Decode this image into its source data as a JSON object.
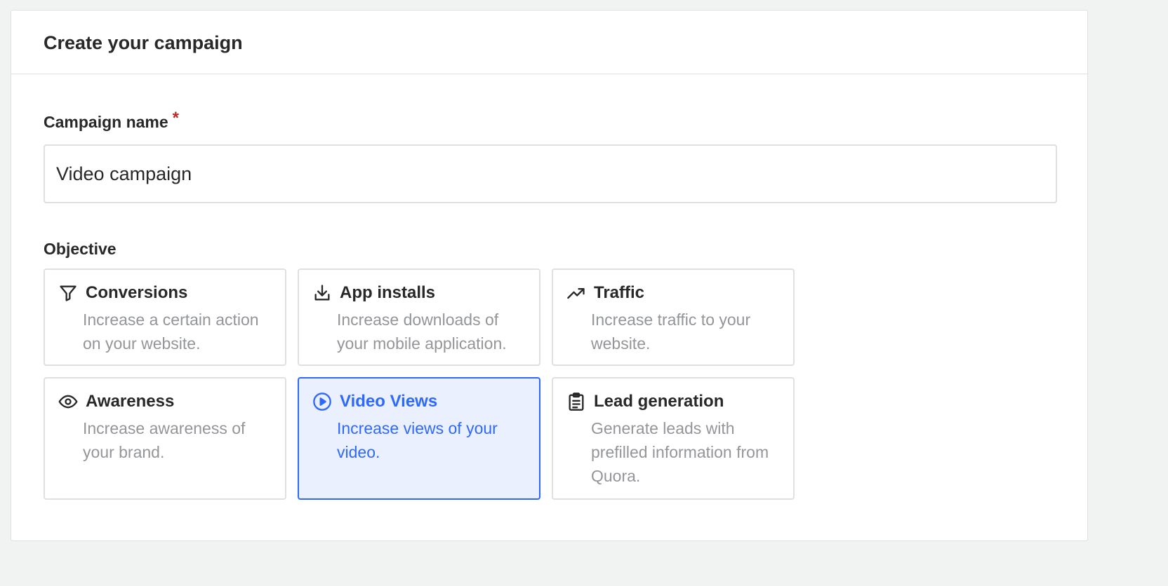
{
  "header": {
    "title": "Create your campaign"
  },
  "campaign_name": {
    "label": "Campaign name",
    "required_marker": "*",
    "value": "Video campaign"
  },
  "objective": {
    "label": "Objective",
    "options": [
      {
        "title": "Conversions",
        "description": "Increase a certain action on your website.",
        "icon": "funnel-icon",
        "selected": false
      },
      {
        "title": "App installs",
        "description": "Increase downloads of your mobile application.",
        "icon": "download-icon",
        "selected": false
      },
      {
        "title": "Traffic",
        "description": "Increase traffic to your website.",
        "icon": "trending-up-icon",
        "selected": false
      },
      {
        "title": "Awareness",
        "description": "Increase awareness of your brand.",
        "icon": "eye-icon",
        "selected": false
      },
      {
        "title": "Video Views",
        "description": "Increase views of your video.",
        "icon": "play-circle-icon",
        "selected": true
      },
      {
        "title": "Lead generation",
        "description": "Generate leads with prefilled information from Quora.",
        "icon": "clipboard-icon",
        "selected": false
      }
    ]
  },
  "colors": {
    "accent": "#2e69ff",
    "selected_background": "#ebf0ff",
    "required": "#b92b27",
    "muted_text": "#939598"
  }
}
